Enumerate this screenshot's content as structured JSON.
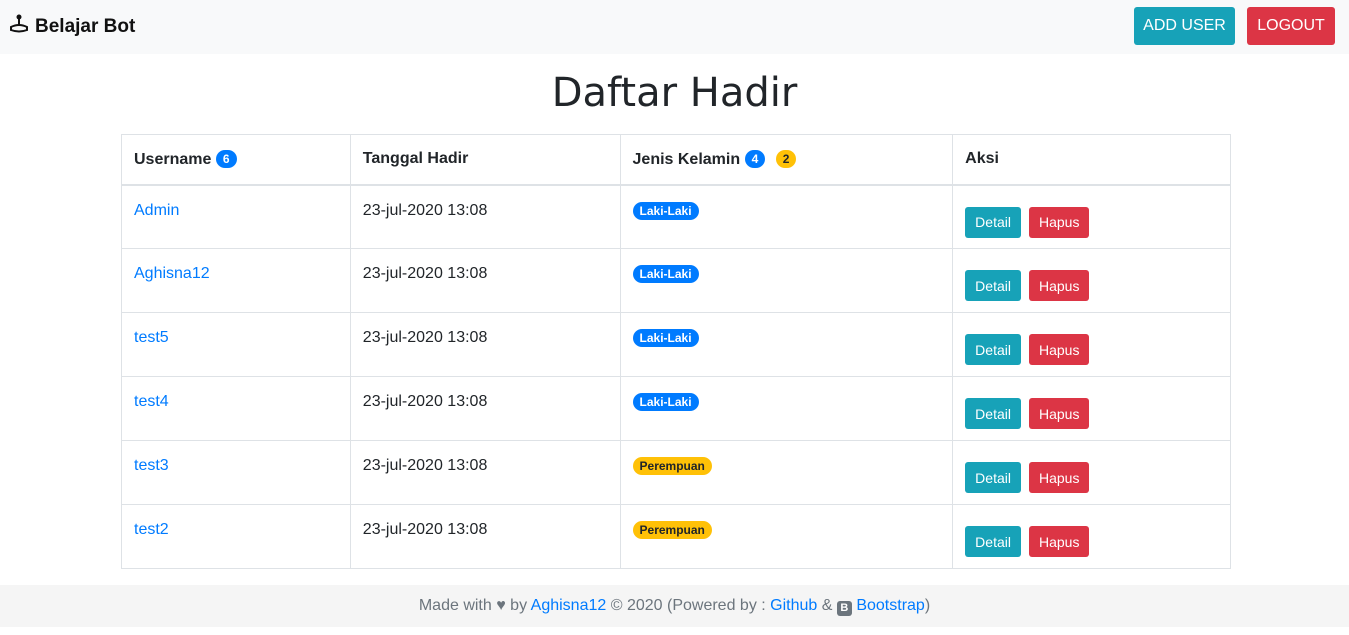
{
  "navbar": {
    "brand": "Belajar Bot",
    "brand_icon": "joystick-icon",
    "add_user_label": "ADD USER",
    "logout_label": "LOGOUT"
  },
  "page_title": "Daftar Hadir",
  "table": {
    "headers": {
      "username": "Username",
      "username_count": "6",
      "tanggal": "Tanggal Hadir",
      "jenis": "Jenis Kelamin",
      "jenis_count_laki": "4",
      "jenis_count_perempuan": "2",
      "aksi": "Aksi"
    },
    "rows": [
      {
        "username": "Admin",
        "tanggal": "23-jul-2020 13:08",
        "gender": "Laki-Laki",
        "gender_color": "#007bff"
      },
      {
        "username": "Aghisna12",
        "tanggal": "23-jul-2020 13:08",
        "gender": "Laki-Laki",
        "gender_color": "#007bff"
      },
      {
        "username": "test5",
        "tanggal": "23-jul-2020 13:08",
        "gender": "Laki-Laki",
        "gender_color": "#007bff"
      },
      {
        "username": "test4",
        "tanggal": "23-jul-2020 13:08",
        "gender": "Laki-Laki",
        "gender_color": "#007bff"
      },
      {
        "username": "test3",
        "tanggal": "23-jul-2020 13:08",
        "gender": "Perempuan",
        "gender_color": "#ffc107"
      },
      {
        "username": "test2",
        "tanggal": "23-jul-2020 13:08",
        "gender": "Perempuan",
        "gender_color": "#ffc107"
      }
    ],
    "detail_label": "Detail",
    "hapus_label": "Hapus"
  },
  "footer": {
    "made_with": "Made with",
    "heart": "♥",
    "by": "by",
    "author": "Aghisna12",
    "year": "© 2020 (Powered by :",
    "github": "Github",
    "amp": "&",
    "bootstrap_icon": "B",
    "bootstrap": "Bootstrap",
    "close": ")"
  },
  "colors": {
    "info": "#17a2b8",
    "danger": "#dc3545",
    "primary": "#007bff",
    "warning": "#ffc107"
  }
}
